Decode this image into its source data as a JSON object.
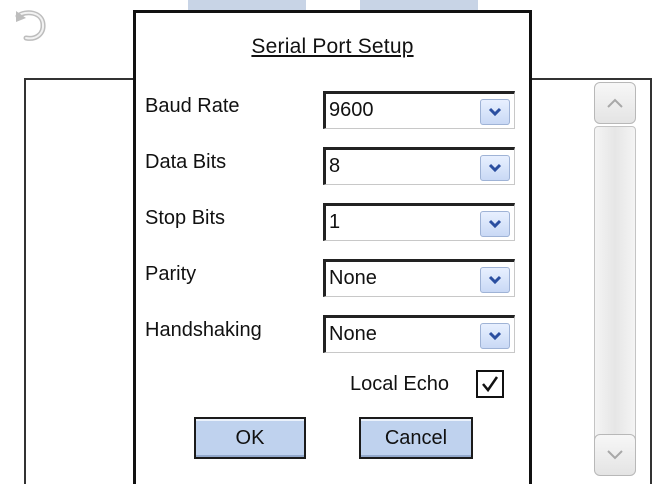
{
  "dialog": {
    "title": "Serial Port Setup",
    "fields": [
      {
        "label": "Baud Rate",
        "value": "9600"
      },
      {
        "label": "Data Bits",
        "value": "8"
      },
      {
        "label": "Stop Bits",
        "value": "1"
      },
      {
        "label": "Parity",
        "value": "None"
      },
      {
        "label": "Handshaking",
        "value": "None"
      }
    ],
    "local_echo": {
      "label": "Local Echo",
      "checked": true
    },
    "ok_label": "OK",
    "cancel_label": "Cancel"
  },
  "colors": {
    "button_fill": "#bfd2ee",
    "dropdown_arrow": "#2b4fa0",
    "border": "#111111"
  },
  "icons": {
    "back": "back-arrow-icon",
    "dropdown": "chevron-down-icon",
    "scroll_up": "chevron-up-icon",
    "scroll_down": "chevron-down-icon",
    "check": "checkmark-icon"
  }
}
